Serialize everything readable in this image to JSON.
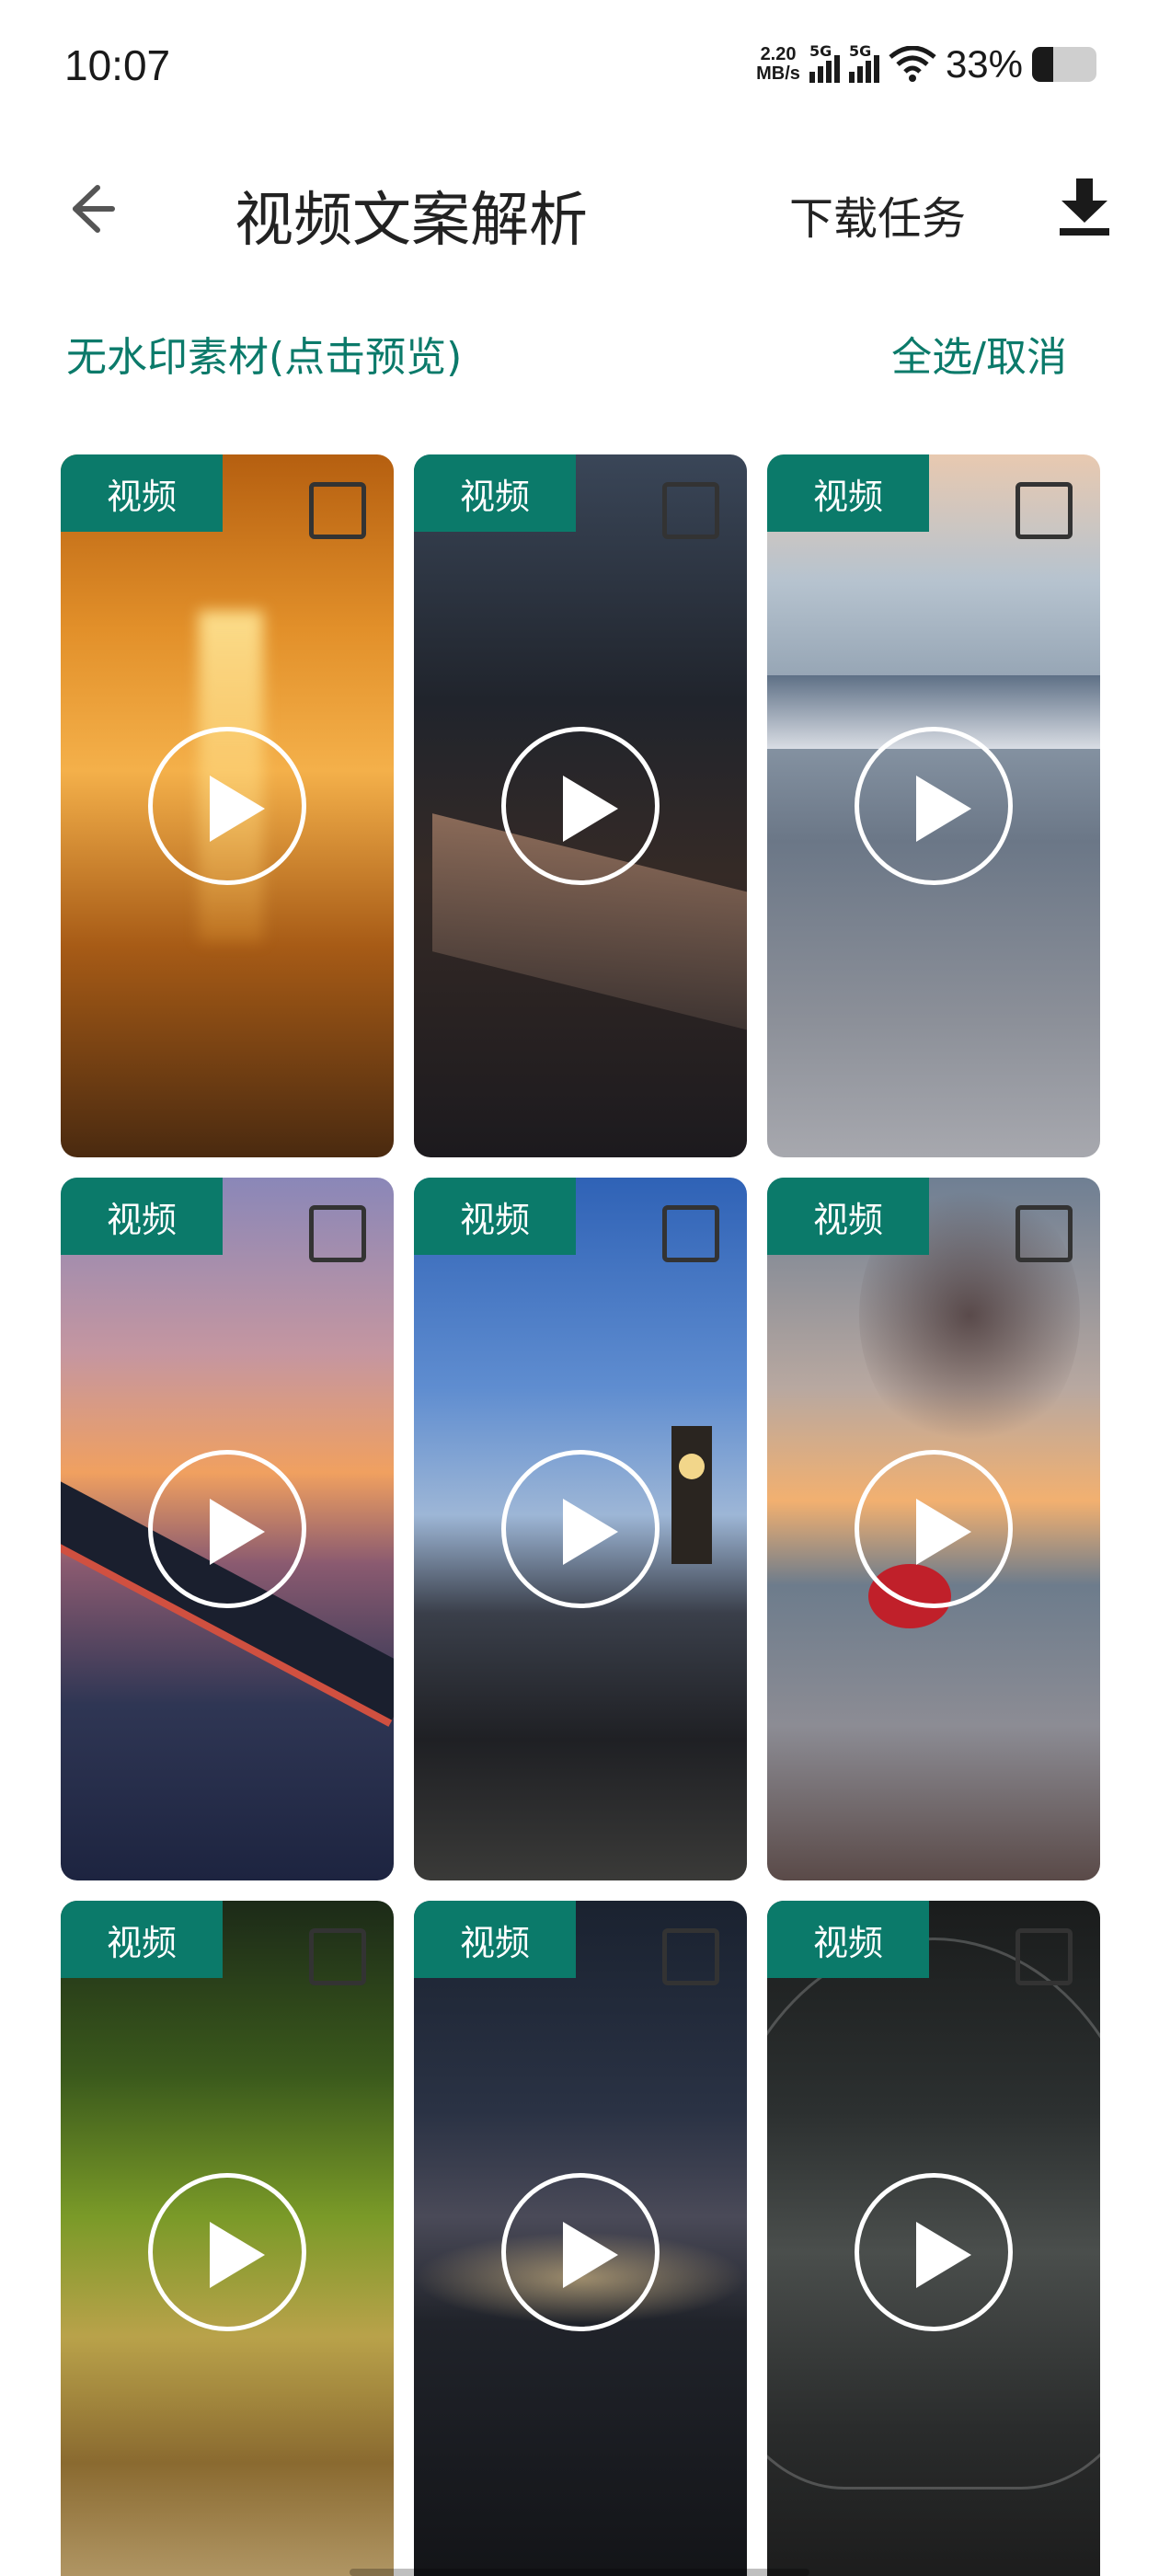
{
  "status_bar": {
    "time": "10:07",
    "net_speed_value": "2.20",
    "net_speed_unit": "MB/s",
    "sim1_label": "5G",
    "sim2_label": "5G",
    "battery_percent": "33%",
    "battery_level": 0.33
  },
  "header": {
    "back_icon": "arrow-left-icon",
    "title": "视频文案解析",
    "download_tasks_label": "下载任务",
    "download_icon": "download-icon"
  },
  "subbar": {
    "left_label": "无水印素材(点击预览)",
    "right_label": "全选/取消"
  },
  "colors": {
    "accent": "#0b7a6a",
    "text": "#222222"
  },
  "media_items": [
    {
      "badge": "视频",
      "selected": false
    },
    {
      "badge": "视频",
      "selected": false
    },
    {
      "badge": "视频",
      "selected": false
    },
    {
      "badge": "视频",
      "selected": false
    },
    {
      "badge": "视频",
      "selected": false
    },
    {
      "badge": "视频",
      "selected": false
    },
    {
      "badge": "视频",
      "selected": false
    },
    {
      "badge": "视频",
      "selected": false
    },
    {
      "badge": "视频",
      "selected": false
    }
  ]
}
